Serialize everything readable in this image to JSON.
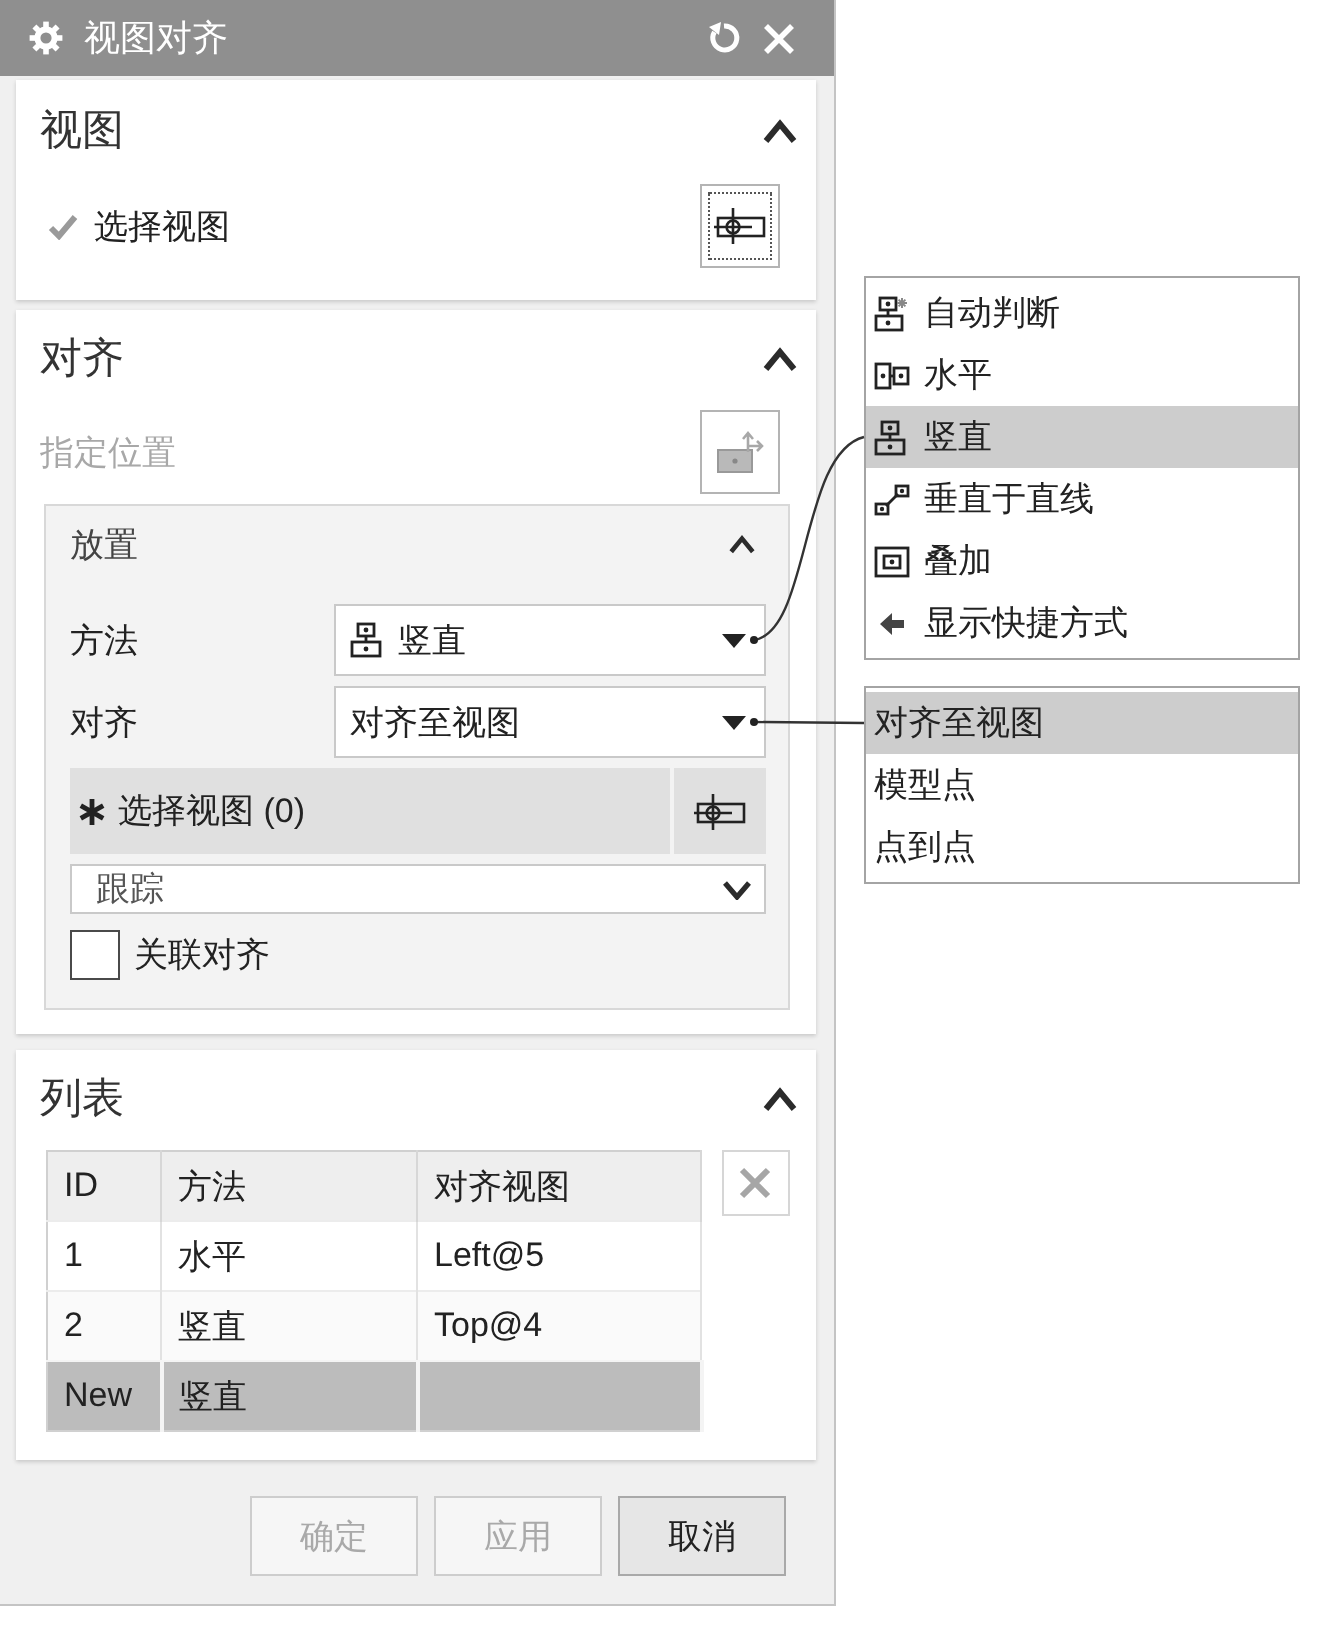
{
  "window": {
    "title": "视图对齐"
  },
  "view_section": {
    "title": "视图",
    "expanded": true,
    "select_view": {
      "label": "选择视图",
      "complete": true,
      "active": false
    }
  },
  "align_section": {
    "title": "对齐",
    "expanded": true,
    "specify_location": {
      "label": "指定位置",
      "disabled": true
    },
    "placement": {
      "title": "放置",
      "expanded": true,
      "method": {
        "label": "方法",
        "value": "竖直",
        "kind": "vertical"
      },
      "alignment": {
        "label": "对齐",
        "value": "对齐至视图"
      },
      "select_view": {
        "label": "选择视图 (0)",
        "complete": false,
        "active": true
      },
      "tracking": {
        "value": "跟踪"
      },
      "associative": {
        "label": "关联对齐",
        "checked": false
      }
    }
  },
  "list_section": {
    "title": "列表",
    "expanded": true,
    "table": {
      "columns": [
        "ID",
        "方法",
        "对齐视图"
      ],
      "rows": [
        {
          "cells": [
            "1",
            "水平",
            "Left@5"
          ],
          "selected": false
        },
        {
          "cells": [
            "2",
            "竖直",
            "Top@4"
          ],
          "selected": false
        },
        {
          "cells": [
            "New",
            "竖直"
          ],
          "selected": true
        }
      ]
    }
  },
  "buttons": [
    {
      "label": "确定",
      "disabled": true
    },
    {
      "label": "应用",
      "disabled": true
    },
    {
      "label": "取消",
      "disabled": false
    }
  ],
  "method_menu": {
    "items": [
      {
        "label": "自动判断",
        "kind": "infer",
        "selected": false
      },
      {
        "label": "水平",
        "kind": "horizontal",
        "selected": false
      },
      {
        "label": "竖直",
        "kind": "vertical",
        "selected": true
      },
      {
        "label": "垂直于直线",
        "kind": "perpendicular",
        "selected": false
      },
      {
        "label": "叠加",
        "kind": "overlay",
        "selected": false
      },
      {
        "label": "显示快捷方式",
        "kind": "shortcuts",
        "selected": false
      }
    ]
  },
  "align_menu": {
    "items": [
      {
        "label": "对齐至视图",
        "selected": true
      },
      {
        "label": "模型点",
        "selected": false
      },
      {
        "label": "点到点",
        "selected": false
      }
    ]
  }
}
